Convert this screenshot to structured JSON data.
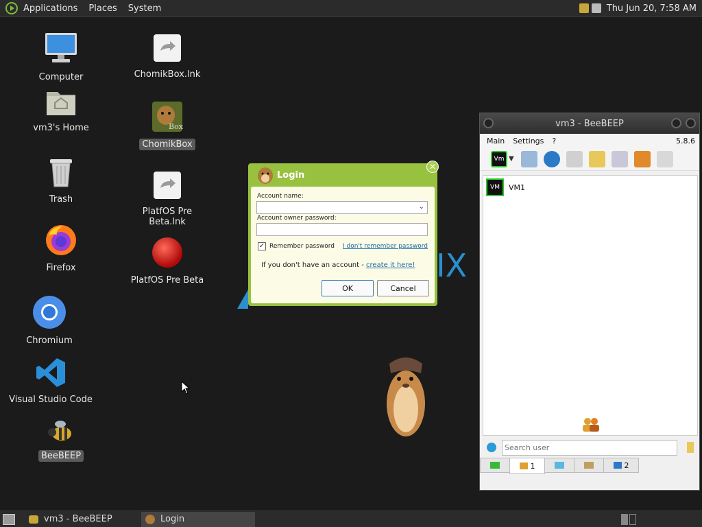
{
  "top_panel": {
    "menus": [
      "Applications",
      "Places",
      "System"
    ],
    "clock": "Thu Jun 20,  7:58 AM"
  },
  "desktop": {
    "icons": [
      {
        "label": "Computer"
      },
      {
        "label": "vm3's Home"
      },
      {
        "label": "Trash"
      },
      {
        "label": "Firefox"
      },
      {
        "label": "Chromium"
      },
      {
        "label": "Visual Studio Code"
      },
      {
        "label": "BeeBEEP"
      },
      {
        "label": "ChomikBox.lnk"
      },
      {
        "label": "ChomikBox"
      },
      {
        "label": "PlatfOS Pre Beta.lnk"
      },
      {
        "label": "PlatfOS Pre Beta"
      }
    ],
    "wallpaper_text": "IX"
  },
  "login": {
    "title": "Login",
    "account_name_label": "Account name:",
    "password_label": "Account owner password:",
    "remember_label": "Remember password",
    "forgot_link": "I don't remember password",
    "no_account_text": "If you don't have an account - ",
    "create_link": "create it here!",
    "ok": "OK",
    "cancel": "Cancel"
  },
  "beebeep": {
    "title": "vm3 - BeeBEEP",
    "menu": [
      "Main",
      "Settings",
      "?"
    ],
    "version": "5.8.6",
    "users": [
      {
        "name": "VM1",
        "avatar": "VM"
      }
    ],
    "search_placeholder": "Search user",
    "tabs": [
      {
        "count": "1"
      },
      {
        "count": ""
      },
      {
        "count": ""
      },
      {
        "count": "2"
      }
    ]
  },
  "taskbar": {
    "tasks": [
      {
        "label": "vm3 - BeeBEEP"
      },
      {
        "label": "Login"
      }
    ]
  }
}
